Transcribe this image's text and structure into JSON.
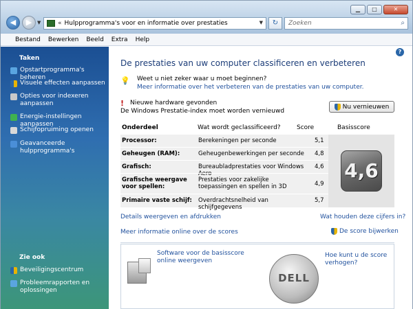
{
  "window": {
    "address": "Hulpprogramma's voor en informatie over prestaties",
    "address_prefix": "«",
    "search_placeholder": "Zoeken",
    "buttons": {
      "minimize": "▁",
      "maximize": "□",
      "close": "✕"
    }
  },
  "menu": [
    "Bestand",
    "Bewerken",
    "Beeld",
    "Extra",
    "Help"
  ],
  "sidebar": {
    "tasks_heading": "Taken",
    "tasks": [
      {
        "label": "Opstartprogramma's beheren",
        "icon": "startup-icon",
        "color": "#5aa5e0"
      },
      {
        "label": "Visuele effecten aanpassen",
        "icon": "shield-icon",
        "color": "#e8b400"
      },
      {
        "label": "Opties voor indexeren aanpassen",
        "icon": "index-icon",
        "color": "#c9c9c9"
      },
      {
        "label": "Energie-instellingen aanpassen",
        "icon": "power-icon",
        "color": "#3fb24f"
      },
      {
        "label": "Schijfopruiming openen",
        "icon": "disk-icon",
        "color": "#d8d8d8"
      },
      {
        "label": "Geavanceerde hulpprogramma's",
        "icon": "tools-icon",
        "color": "#4a8fd8"
      }
    ],
    "see_also_heading": "Zie ook",
    "see_also": [
      {
        "label": "Beveiligingscentrum",
        "icon": "security-icon",
        "color": "#e8b400"
      },
      {
        "label": "Probleemrapporten en oplossingen",
        "icon": "report-icon",
        "color": "#5aa5e0"
      }
    ]
  },
  "main": {
    "title": "De prestaties van uw computer classificeren en verbeteren",
    "tip_text": "Weet u niet zeker waar u moet beginnen?",
    "tip_link": "Meer informatie over het verbeteren van de prestaties van uw computer.",
    "warning_text": "Nieuwe hardware gevonden",
    "warning_sub": "De Windows Prestatie-index moet worden vernieuwd",
    "refresh_button": "Nu vernieuwen",
    "table": {
      "headers": {
        "component": "Onderdeel",
        "rated": "Wat wordt geclassificeerd?",
        "score": "Score",
        "base": "Basisscore"
      },
      "rows": [
        {
          "component": "Processor:",
          "desc": "Berekeningen per seconde",
          "score": "5,1"
        },
        {
          "component": "Geheugen (RAM):",
          "desc": "Geheugenbewerkingen per seconde",
          "score": "4,8"
        },
        {
          "component": "Grafisch:",
          "desc": "Bureaubladprestaties voor Windows Aero",
          "score": "4,6"
        },
        {
          "component": "Grafische weergave voor spellen:",
          "desc": "Prestaties voor zakelijke toepassingen en spellen in 3D",
          "score": "4,9"
        },
        {
          "component": "Primaire vaste schijf:",
          "desc": "Overdrachtsnelheid van schijfgegevens",
          "score": "5,7"
        }
      ],
      "base_score": "4,6"
    },
    "link_details": "Details weergeven en afdrukken",
    "link_what": "Wat houden deze cijfers in?",
    "link_online": "Meer informatie online over de scores",
    "link_update": "De score bijwerken",
    "promo_software": "Software voor de basisscore online weergeven",
    "promo_improve": "Hoe kunt u de score verhogen?",
    "dell_text": "DELL"
  }
}
